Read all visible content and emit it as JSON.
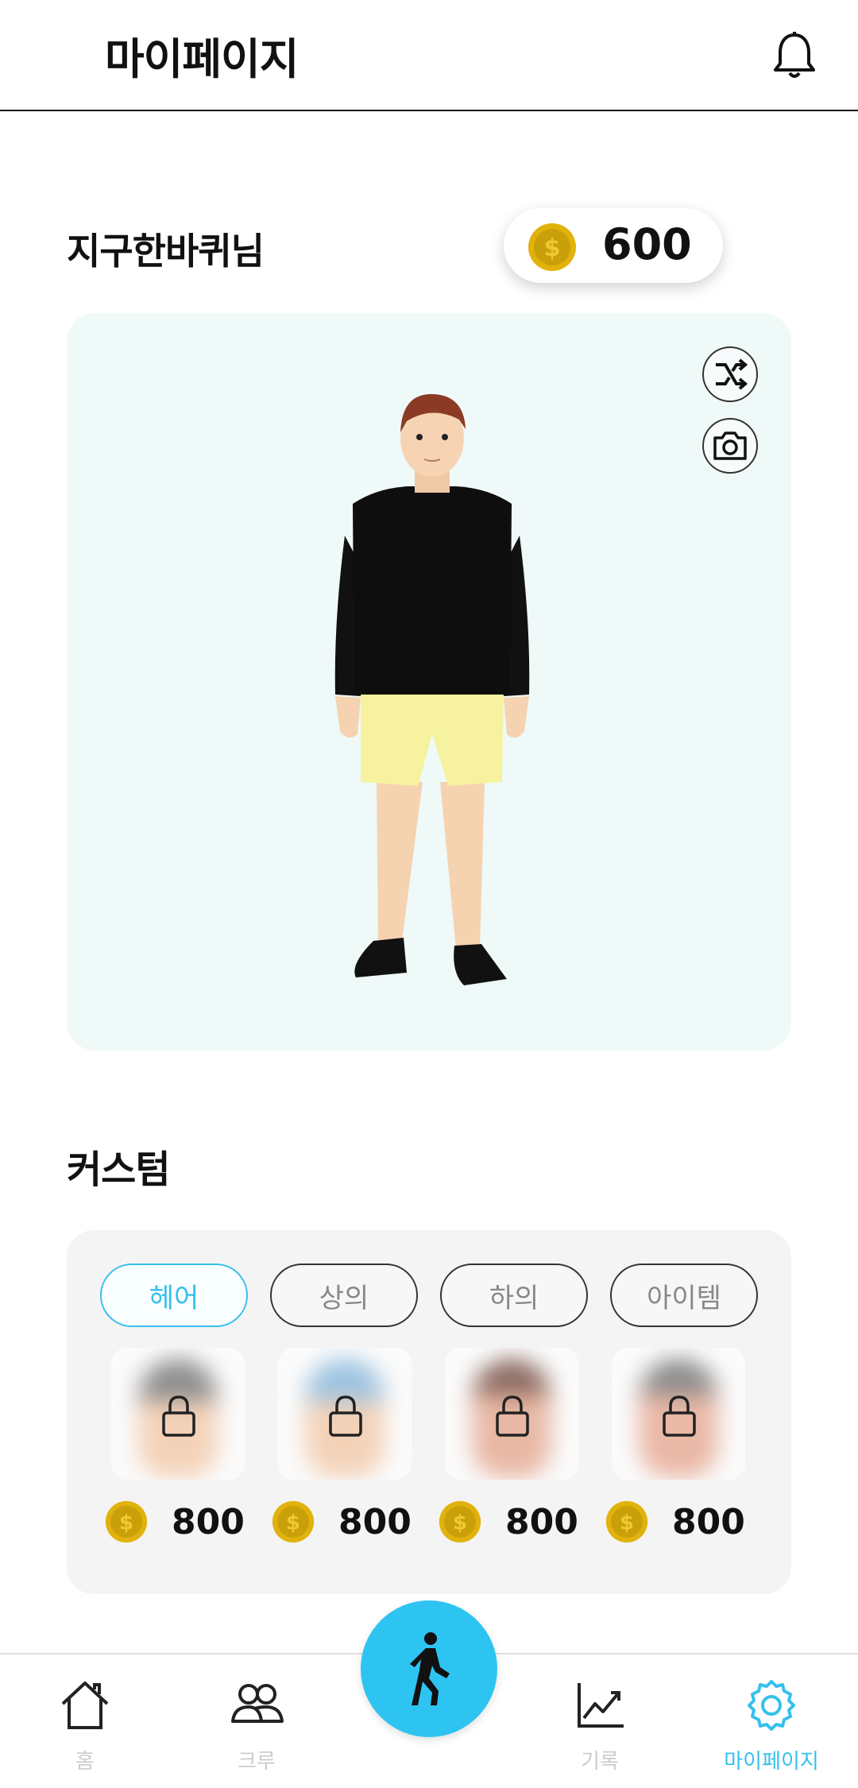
{
  "header": {
    "title": "마이페이지",
    "icon": "bell-icon"
  },
  "profile": {
    "username": "지구한바퀴님",
    "coins": "600"
  },
  "avatar": {
    "actions": [
      "shuffle-icon",
      "camera-icon"
    ]
  },
  "custom": {
    "title": "커스텀",
    "tabs": [
      {
        "label": "헤어",
        "active": true
      },
      {
        "label": "상의",
        "active": false
      },
      {
        "label": "하의",
        "active": false
      },
      {
        "label": "아이템",
        "active": false
      }
    ],
    "items": [
      {
        "price": "800",
        "locked": true
      },
      {
        "price": "800",
        "locked": true
      },
      {
        "price": "800",
        "locked": true
      },
      {
        "price": "800",
        "locked": true
      }
    ]
  },
  "nav": {
    "items": [
      {
        "label": "홈",
        "icon": "home-icon"
      },
      {
        "label": "크루",
        "icon": "crew-icon"
      },
      {
        "label": "기록",
        "icon": "chart-icon"
      },
      {
        "label": "마이페이지",
        "icon": "gear-icon",
        "active": true
      }
    ],
    "fab_icon": "walking-icon"
  },
  "colors": {
    "accent": "#35c0ec",
    "fab": "#2ec4f2",
    "avatar_bg": "#eef9f8",
    "coin": "#e1b20c"
  }
}
